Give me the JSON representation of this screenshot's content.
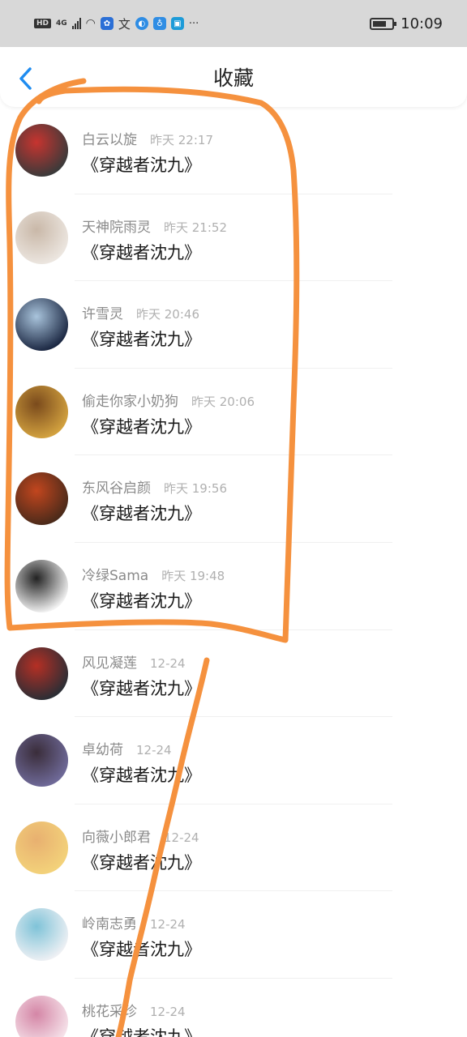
{
  "status_bar": {
    "network": "4G",
    "hd": "HD",
    "time": "10:09",
    "more": "···"
  },
  "header": {
    "title": "收藏"
  },
  "icons": {
    "back": "chevron-left-icon",
    "accent_color": "#1f8cf0",
    "annotation_color": "#f5913e"
  },
  "items": [
    {
      "name": "白云以旋",
      "time": "昨天 22:17",
      "content": "《穿越者沈九》",
      "avatar_colors": [
        "#3a3a3a",
        "#c7342f"
      ]
    },
    {
      "name": "天神院雨灵",
      "time": "昨天 21:52",
      "content": "《穿越者沈九》",
      "avatar_colors": [
        "#ece6e0",
        "#c9b8a8"
      ]
    },
    {
      "name": "许雪灵",
      "time": "昨天 20:46",
      "content": "《穿越者沈九》",
      "avatar_colors": [
        "#1b2742",
        "#a9c4dc"
      ]
    },
    {
      "name": "偷走你家小奶狗",
      "time": "昨天 20:06",
      "content": "《穿越者沈九》",
      "avatar_colors": [
        "#d3a23f",
        "#7a4a1c"
      ]
    },
    {
      "name": "东风谷启颜",
      "time": "昨天 19:56",
      "content": "《穿越者沈九》",
      "avatar_colors": [
        "#4a2a1a",
        "#c2461e"
      ]
    },
    {
      "name": "冷绿Sama",
      "time": "昨天 19:48",
      "content": "《穿越者沈九》",
      "avatar_colors": [
        "#f2f2f2",
        "#222222"
      ]
    },
    {
      "name": "风见凝莲",
      "time": "12-24",
      "content": "《穿越者沈九》",
      "avatar_colors": [
        "#2b2e35",
        "#b52f24"
      ]
    },
    {
      "name": "卓幼荷",
      "time": "12-24",
      "content": "《穿越者沈九》",
      "avatar_colors": [
        "#6f6a99",
        "#3a2d3a"
      ]
    },
    {
      "name": "向薇小郎君",
      "time": "12-24",
      "content": "《穿越者沈九》",
      "avatar_colors": [
        "#f3d27a",
        "#e8b070"
      ]
    },
    {
      "name": "岭南志勇",
      "time": "12-24",
      "content": "《穿越者沈九》",
      "avatar_colors": [
        "#eef0f4",
        "#7fc3d8"
      ]
    },
    {
      "name": "桃花采珍",
      "time": "12-24",
      "content": "《穿越者沈九》",
      "avatar_colors": [
        "#f6e3ea",
        "#d486a6"
      ]
    }
  ]
}
